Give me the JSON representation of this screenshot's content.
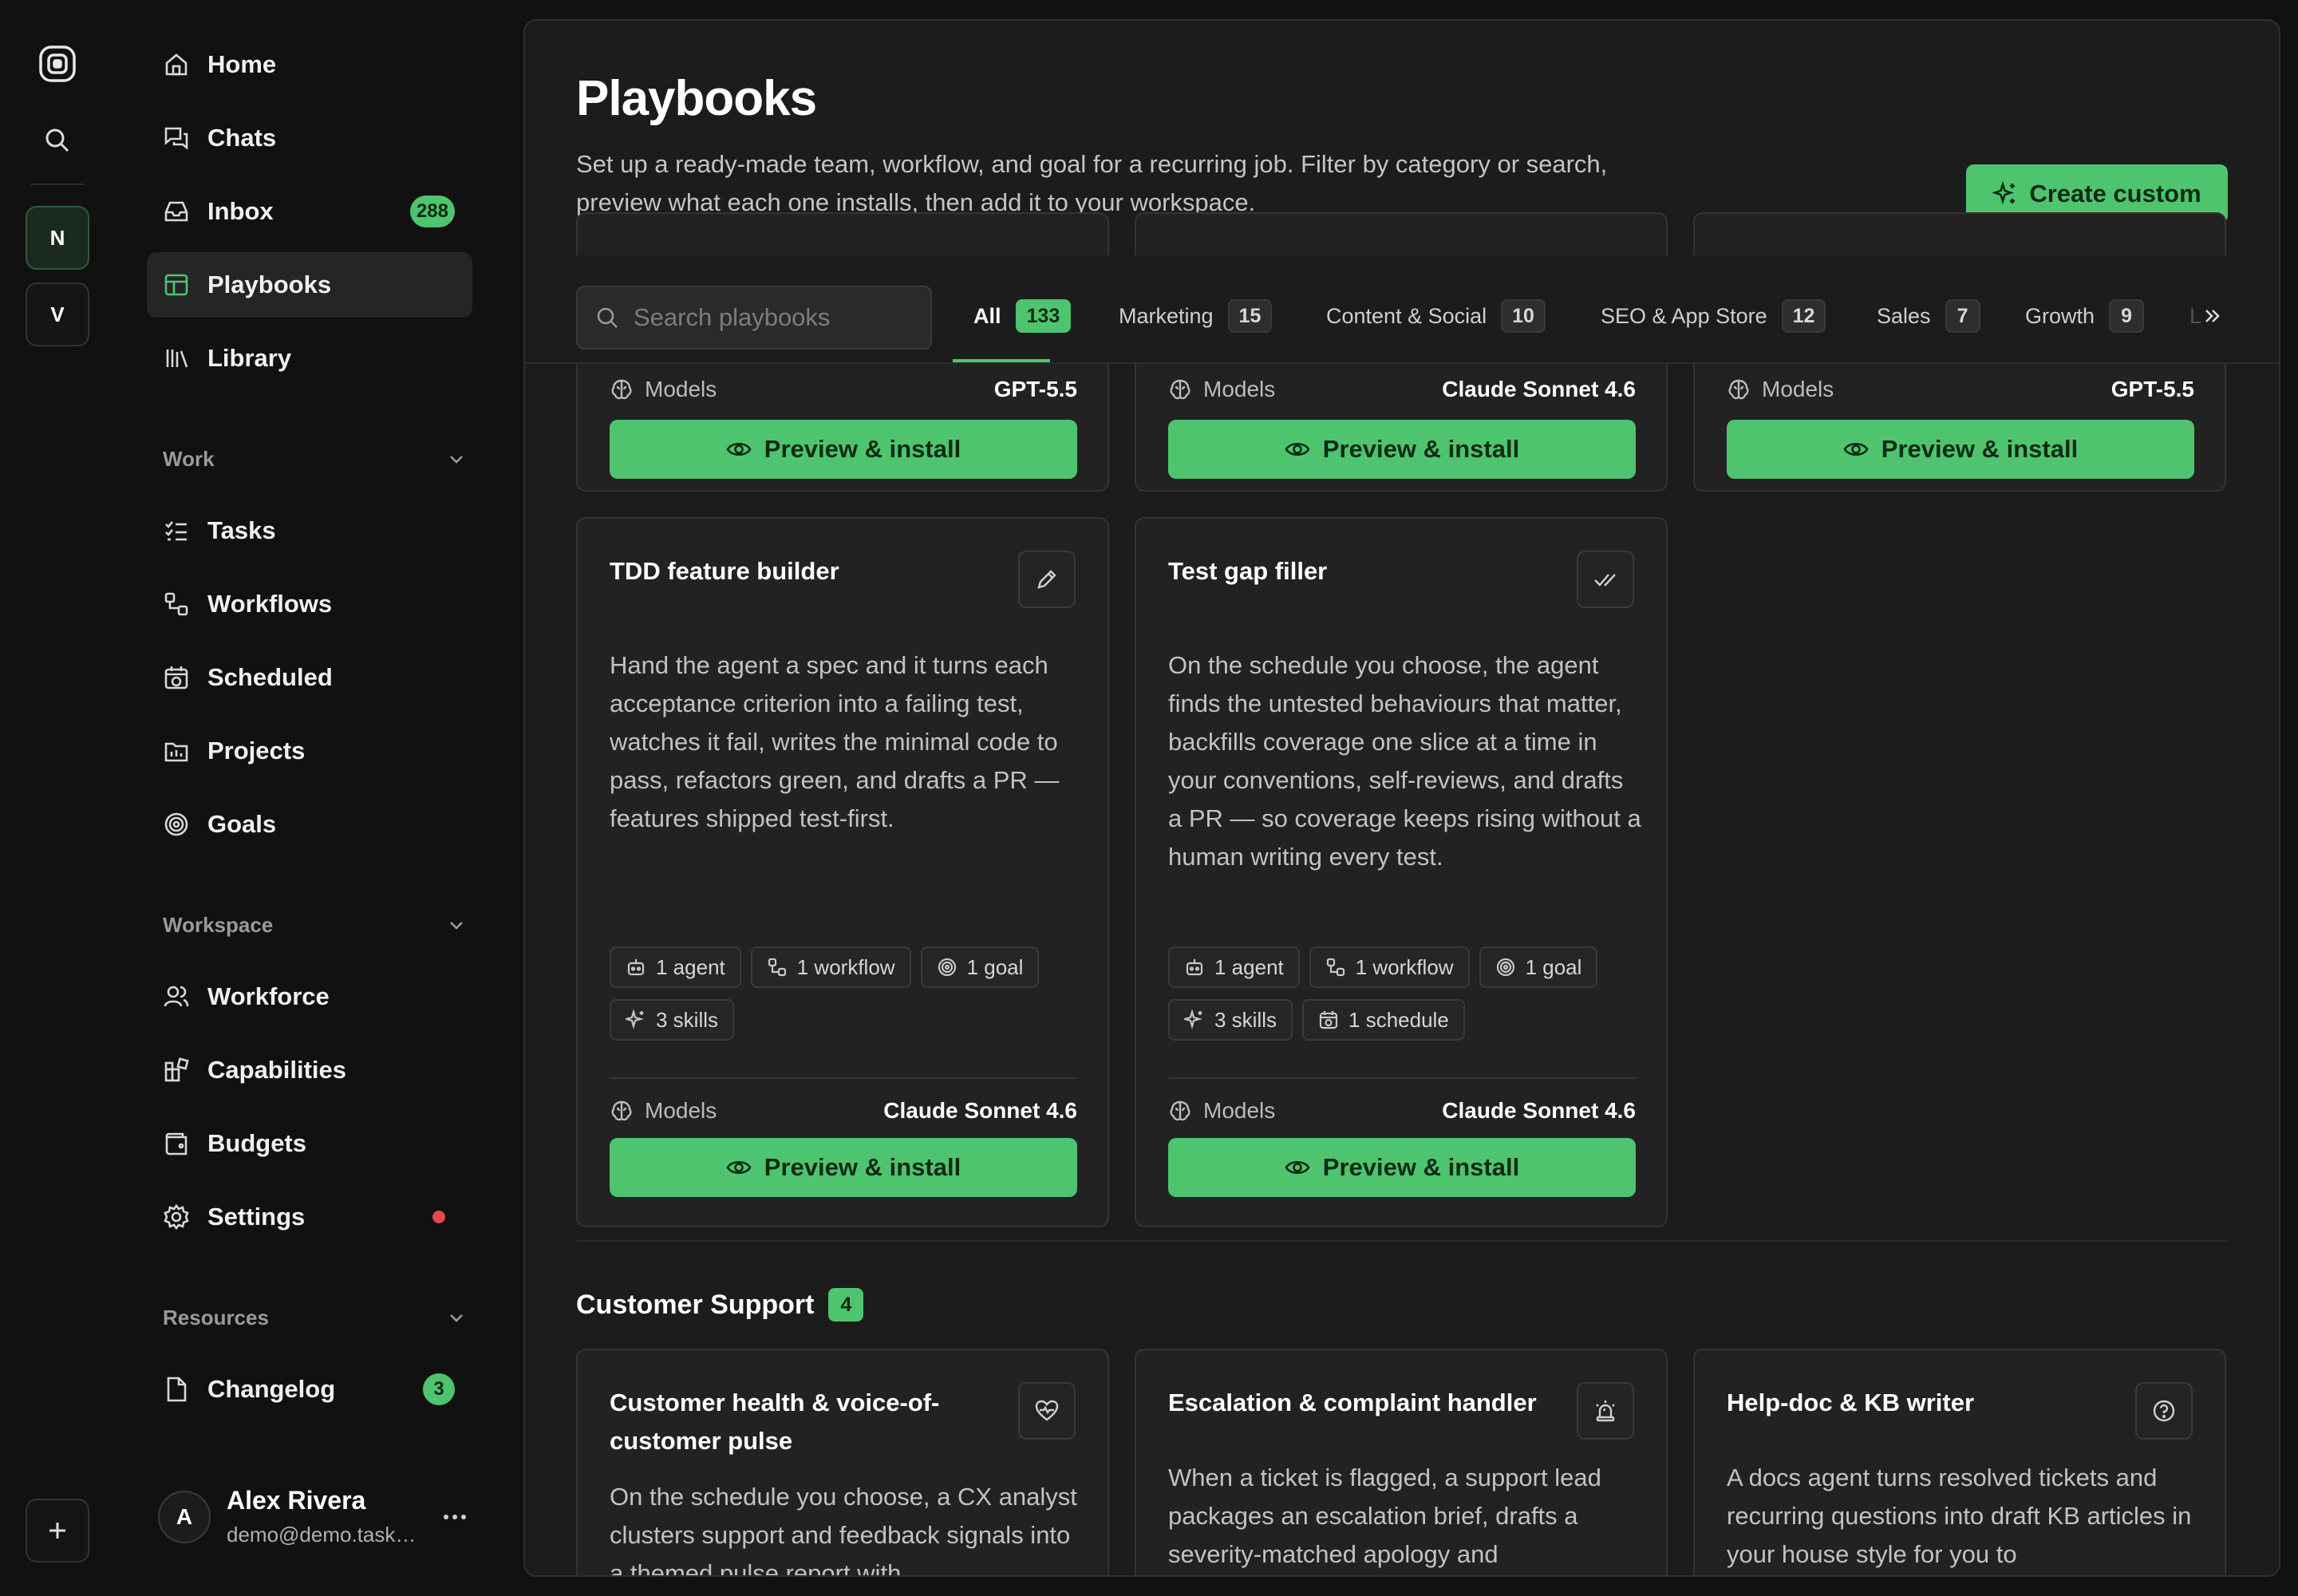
{
  "workspaces": [
    {
      "initial": "N",
      "active": true
    },
    {
      "initial": "V",
      "active": false
    }
  ],
  "sidebar": {
    "primary": [
      {
        "label": "Home",
        "icon": "home-icon"
      },
      {
        "label": "Chats",
        "icon": "chats-icon"
      },
      {
        "label": "Inbox",
        "icon": "inbox-icon",
        "badge": "288"
      },
      {
        "label": "Playbooks",
        "icon": "playbooks-icon",
        "active": true
      },
      {
        "label": "Library",
        "icon": "library-icon"
      }
    ],
    "work": {
      "label": "Work",
      "items": [
        {
          "label": "Tasks",
          "icon": "tasks-icon"
        },
        {
          "label": "Workflows",
          "icon": "workflows-icon"
        },
        {
          "label": "Scheduled",
          "icon": "scheduled-icon"
        },
        {
          "label": "Projects",
          "icon": "projects-icon"
        },
        {
          "label": "Goals",
          "icon": "goals-icon"
        }
      ]
    },
    "workspace": {
      "label": "Workspace",
      "items": [
        {
          "label": "Workforce",
          "icon": "workforce-icon"
        },
        {
          "label": "Capabilities",
          "icon": "capabilities-icon"
        },
        {
          "label": "Budgets",
          "icon": "budgets-icon"
        },
        {
          "label": "Settings",
          "icon": "settings-icon",
          "dot_color": "#e5484d"
        }
      ]
    },
    "resources": {
      "label": "Resources",
      "items": [
        {
          "label": "Changelog",
          "icon": "changelog-icon",
          "badge": "3"
        }
      ]
    },
    "user": {
      "initial": "A",
      "name": "Alex Rivera",
      "email": "demo@demo.taskade.com"
    }
  },
  "main": {
    "title": "Playbooks",
    "description": "Set up a ready-made team, workflow, and goal for a recurring job. Filter by category or search, preview what each one installs, then add it to your workspace.",
    "create_label": "Create custom",
    "search_placeholder": "Search playbooks",
    "tabs": [
      {
        "label": "All",
        "count": "133",
        "active": true
      },
      {
        "label": "Marketing",
        "count": "15"
      },
      {
        "label": "Content & Social",
        "count": "10"
      },
      {
        "label": "SEO & App Store",
        "count": "12"
      },
      {
        "label": "Sales",
        "count": "7"
      },
      {
        "label": "Growth",
        "count": "9"
      }
    ],
    "tab_overflow_label": "L",
    "top_cards": [
      {
        "models_label": "Models",
        "model": "GPT-5.5",
        "button": "Preview & install"
      },
      {
        "models_label": "Models",
        "model": "Claude Sonnet 4.6",
        "button": "Preview & install"
      },
      {
        "models_label": "Models",
        "model": "GPT-5.5",
        "button": "Preview & install"
      }
    ],
    "cards": [
      {
        "title": "TDD feature builder",
        "icon": "pencil-icon",
        "description": "Hand the agent a spec and it turns each acceptance criterion into a failing test, watches it fail, writes the minimal code to pass, refactors green, and drafts a PR — features shipped test-first.",
        "chips": [
          {
            "label": "1 agent",
            "icon": "agent-icon"
          },
          {
            "label": "1 workflow",
            "icon": "workflow-icon"
          },
          {
            "label": "1 goal",
            "icon": "goal-icon"
          },
          {
            "label": "3 skills",
            "icon": "skills-icon"
          }
        ],
        "models_label": "Models",
        "model": "Claude Sonnet 4.6",
        "button": "Preview & install"
      },
      {
        "title": "Test gap filler",
        "icon": "double-check-icon",
        "description": "On the schedule you choose, the agent finds the untested behaviours that matter, backfills coverage one slice at a time in your conventions, self-reviews, and drafts a PR — so coverage keeps rising without a human writing every test.",
        "chips": [
          {
            "label": "1 agent",
            "icon": "agent-icon"
          },
          {
            "label": "1 workflow",
            "icon": "workflow-icon"
          },
          {
            "label": "1 goal",
            "icon": "goal-icon"
          },
          {
            "label": "3 skills",
            "icon": "skills-icon"
          },
          {
            "label": "1 schedule",
            "icon": "schedule-icon"
          }
        ],
        "models_label": "Models",
        "model": "Claude Sonnet 4.6",
        "button": "Preview & install"
      }
    ],
    "support_section": {
      "title": "Customer Support",
      "count": "4",
      "cards": [
        {
          "title": "Customer health & voice-of-customer pulse",
          "icon": "heart-pulse-icon",
          "description": "On the schedule you choose, a CX analyst clusters support and feedback signals into a themed pulse report with"
        },
        {
          "title": "Escalation & complaint handler",
          "icon": "alarm-icon",
          "description": "When a ticket is flagged, a support lead packages an escalation brief, drafts a severity-matched apology and"
        },
        {
          "title": "Help-doc & KB writer",
          "icon": "help-circle-icon",
          "description": "A docs agent turns resolved tickets and recurring questions into draft KB articles in your house style for you to"
        }
      ]
    }
  },
  "colors": {
    "accent": "#4fc46e",
    "alert": "#e5484d",
    "background": "#111111",
    "panel": "#1c1c1c"
  }
}
